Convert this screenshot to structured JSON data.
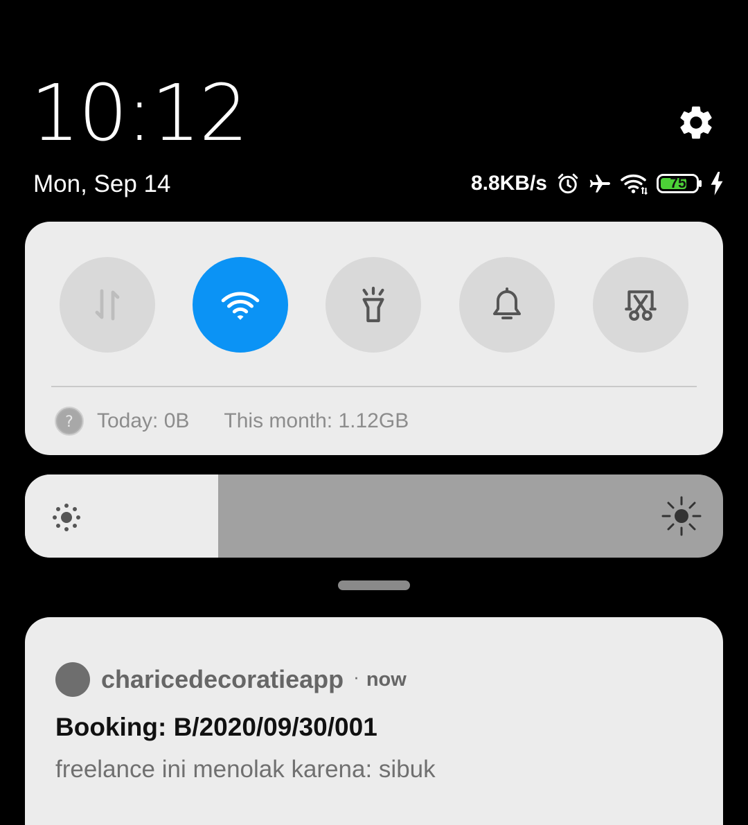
{
  "header": {
    "time": "10:12",
    "date": "Mon, Sep 14"
  },
  "status_bar": {
    "network_speed": "8.8KB/s",
    "battery_level": "75",
    "icons": [
      "alarm-icon",
      "airplane-icon",
      "wifi-icon",
      "battery-icon",
      "charging-icon"
    ]
  },
  "quick_settings": {
    "tiles": [
      {
        "name": "mobile-data",
        "icon": "data-arrows-icon",
        "active": false
      },
      {
        "name": "wifi",
        "icon": "wifi-icon",
        "active": true
      },
      {
        "name": "flashlight",
        "icon": "flashlight-icon",
        "active": false
      },
      {
        "name": "sound",
        "icon": "bell-icon",
        "active": false
      },
      {
        "name": "screenshot",
        "icon": "scissors-icon",
        "active": false
      }
    ],
    "usage_today": "Today: 0B",
    "usage_month": "This month: 1.12GB"
  },
  "brightness": {
    "level": 0.277
  },
  "notification": {
    "app_name": "charicedecoratieapp",
    "separator": "·",
    "time": "now",
    "title": "Booking: B/2020/09/30/001",
    "body": "freelance ini menolak karena: sibuk"
  },
  "colors": {
    "accent": "#0b93f5",
    "battery_fill": "#4cd137",
    "card_bg": "#ececec",
    "tile_bg": "#d9d9d9"
  }
}
